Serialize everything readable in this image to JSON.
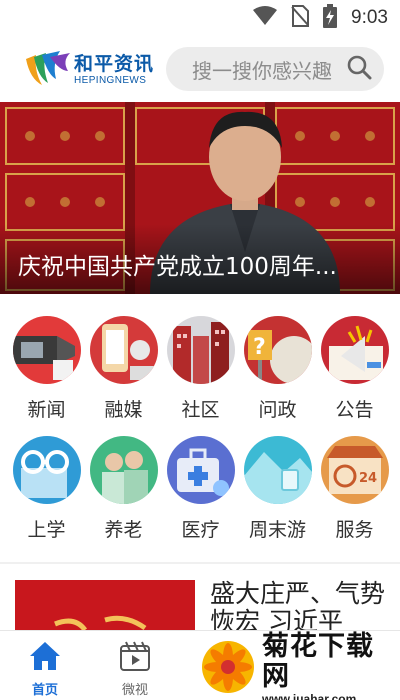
{
  "status_bar": {
    "time": "9:03",
    "icons": [
      "wifi-icon",
      "no-sim-icon",
      "battery-charging-icon"
    ]
  },
  "header": {
    "logo_cn": "和平资讯",
    "logo_en": "HEPINGNEWS",
    "search_placeholder": "搜一搜你感兴趣",
    "search_icon": "search-icon"
  },
  "banner": {
    "title": "庆祝中国共产党成立100周年..."
  },
  "categories": [
    {
      "label": "新闻",
      "icon": "news-icon"
    },
    {
      "label": "融媒",
      "icon": "media-icon"
    },
    {
      "label": "社区",
      "icon": "community-icon"
    },
    {
      "label": "问政",
      "icon": "inquiry-icon"
    },
    {
      "label": "公告",
      "icon": "announcement-icon"
    },
    {
      "label": "上学",
      "icon": "school-icon"
    },
    {
      "label": "养老",
      "icon": "elderly-care-icon"
    },
    {
      "label": "医疗",
      "icon": "medical-icon"
    },
    {
      "label": "周末游",
      "icon": "weekend-travel-icon"
    },
    {
      "label": "服务",
      "icon": "service-icon"
    }
  ],
  "news_item": {
    "headline": "盛大庄严、气势恢宏 习近平"
  },
  "tabbar": {
    "items": [
      {
        "label": "首页",
        "icon": "home-icon",
        "active": true
      },
      {
        "label": "微视",
        "icon": "video-icon",
        "active": false
      }
    ]
  },
  "watermark": {
    "big": "菊花下载网",
    "small": "www.juahar.com"
  },
  "colors": {
    "brand_blue": "#0b5aa8",
    "tab_active": "#1d6fd6",
    "banner_red": "#b0141b"
  }
}
